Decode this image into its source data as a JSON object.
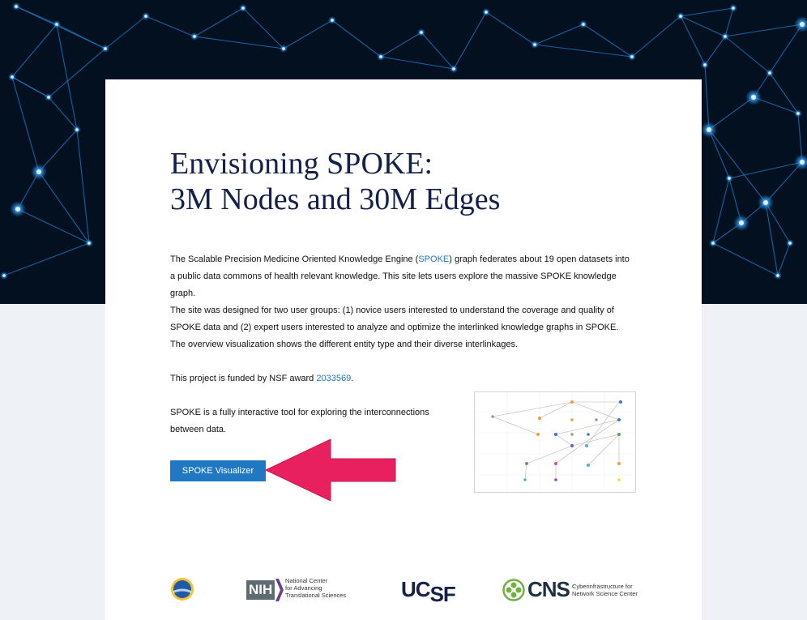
{
  "hero": {
    "background": "network-graph-background",
    "bg_color": "#03101f",
    "line_color": "#1b7fd0"
  },
  "page": {
    "title_line1": "Envisioning SPOKE:",
    "title_line2": "3M Nodes and 30M Edges"
  },
  "intro": {
    "p1_before": "The Scalable Precision Medicine Oriented Knowledge Engine (",
    "p1_link": "SPOKE",
    "p1_after": ") graph federates about 19 open datasets into a public data commons of health relevant knowledge. This site lets users explore the massive SPOKE knowledge graph.",
    "p2": "The site was designed for two user groups: (1) novice users interested to understand the coverage and quality of SPOKE data and (2) expert users interested to analyze and optimize the interlinked knowledge graphs in SPOKE. The overview visualization shows the different entity type and their diverse interlinkages.",
    "p3_before": "This project is funded by NSF award ",
    "p3_link": "2033569",
    "p3_after": ".",
    "p4": "SPOKE is a fully interactive tool for exploring the interconnections between data."
  },
  "cta": {
    "label": "SPOKE Visualizer",
    "color": "#1f78c1"
  },
  "annotation": {
    "arrow_color": "#e8205f"
  },
  "thumbnail": {
    "alt": "SPOKE overview visualization"
  },
  "logos": {
    "nsf": "nsf-seal-icon",
    "nih_abbr": "NIH",
    "nih_line1": "National Center",
    "nih_line2": "for Advancing",
    "nih_line3": "Translational Sciences",
    "ucsf_a": "UC",
    "ucsf_b": "SF",
    "cns_abbr": "CNS",
    "cns_line1": "Cyberinfrastructure for",
    "cns_line2": "Network Science Center"
  }
}
